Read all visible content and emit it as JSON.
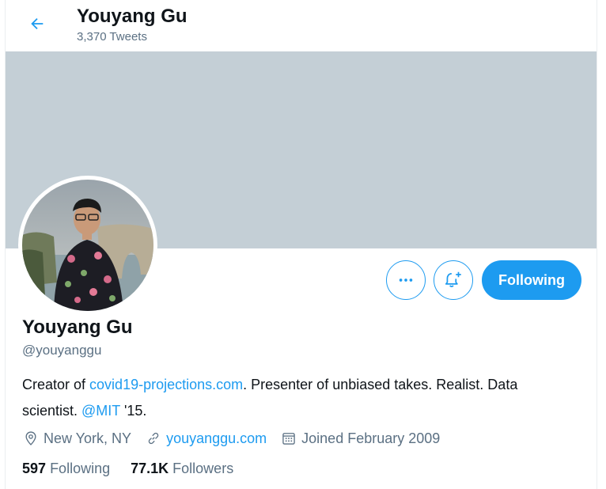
{
  "header": {
    "title": "Youyang Gu",
    "tweet_count": "3,370 Tweets",
    "back_icon": "arrow-left-icon"
  },
  "profile": {
    "name": "Youyang Gu",
    "handle": "@youyanggu",
    "bio": {
      "part1": "Creator of ",
      "link1": "covid19-projections.com",
      "part2": ". Presenter of unbiased takes. Realist. Data scientist. ",
      "mention": "@MIT",
      "part3": " '15."
    },
    "location": "New York, NY",
    "website": "youyanggu.com",
    "joined": "Joined February 2009",
    "following_count": "597",
    "following_label": "Following",
    "followers_count": "77.1K",
    "followers_label": "Followers"
  },
  "actions": {
    "more_icon": "more-dots-icon",
    "notify_icon": "bell-plus-icon",
    "follow_label": "Following"
  },
  "colors": {
    "accent": "#1d9bf0",
    "banner": "#c4cfd6",
    "secondary_text": "#5b7083"
  }
}
